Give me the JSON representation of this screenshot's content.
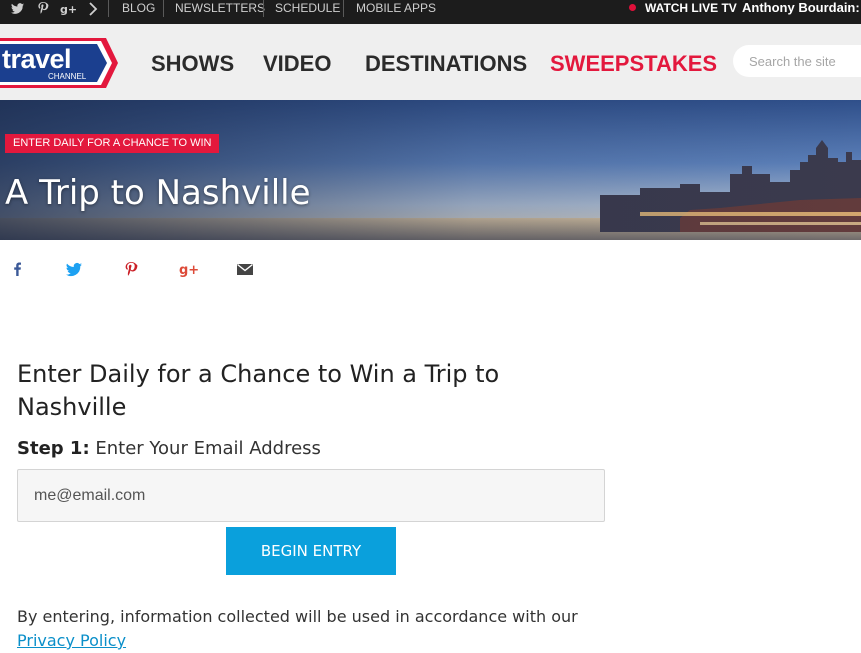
{
  "topbar": {
    "social_icons": [
      "twitter-icon",
      "pinterest-icon",
      "google-plus-icon",
      "chevron-right-icon"
    ],
    "links": [
      "BLOG",
      "NEWSLETTERS",
      "SCHEDULE",
      "MOBILE APPS"
    ],
    "live_label": "WATCH LIVE TV",
    "promo": "Anthony Bourdain:",
    "live_dot_color": "#e0103a"
  },
  "header": {
    "logo": {
      "main": "travel",
      "sub": "CHANNEL"
    },
    "nav": [
      "SHOWS",
      "VIDEO",
      "DESTINATIONS",
      "SWEEPSTAKES"
    ],
    "active_nav": "SWEEPSTAKES",
    "search_placeholder": "Search the site"
  },
  "hero": {
    "tag": "ENTER DAILY FOR A CHANCE TO WIN",
    "title": "A Trip to Nashville"
  },
  "share_icons": [
    "facebook-icon",
    "twitter-icon",
    "pinterest-icon",
    "google-plus-icon",
    "email-icon"
  ],
  "form": {
    "title": "Enter Daily for a Chance to Win a Trip to Nashville",
    "step_label": "Step 1:",
    "step_text": "Enter Your Email Address",
    "email_placeholder": "me@email.com",
    "button_label": "BEGIN ENTRY",
    "legal_text": "By entering, information collected will be used in accordance with our",
    "privacy_link": "Privacy Policy"
  },
  "colors": {
    "accent_red": "#e3183d",
    "button_blue": "#0aa0dc",
    "link_blue": "#0a8fc9",
    "logo_blue": "#1b3f8f",
    "topbar_bg": "#1c1c1c",
    "nav_bg": "#efefef"
  }
}
